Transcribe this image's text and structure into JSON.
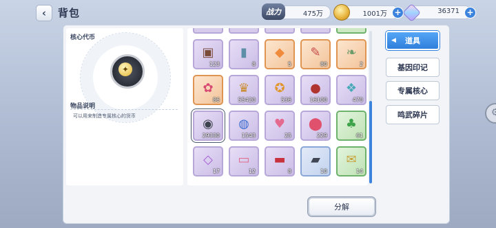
{
  "header": {
    "title": "背包",
    "resources": {
      "power": {
        "label": "战力",
        "value": "475万"
      },
      "coin": {
        "value": "1001万"
      },
      "gem": {
        "value": "36371"
      }
    }
  },
  "detail": {
    "item_name": "核心代币",
    "desc_title": "物品说明",
    "desc_text": "可以用来制造专属核心的货币"
  },
  "grid": {
    "items": [
      {
        "name": "chip",
        "count": "123",
        "frame": "purple"
      },
      {
        "name": "battery",
        "count": "8",
        "frame": "purple"
      },
      {
        "name": "orange-crystal",
        "count": "5",
        "frame": "orange"
      },
      {
        "name": "candy-cane",
        "count": "80",
        "frame": "orange"
      },
      {
        "name": "leaf-badge",
        "count": "2",
        "frame": "orange"
      },
      {
        "name": "pink-ribbon",
        "count": "86",
        "frame": "orange"
      },
      {
        "name": "trophy",
        "count": "55420",
        "frame": "purple"
      },
      {
        "name": "medal",
        "count": "536",
        "frame": "purple"
      },
      {
        "name": "red-seal",
        "count": "16100",
        "frame": "purple"
      },
      {
        "name": "cube-pack",
        "count": "470",
        "frame": "purple"
      },
      {
        "name": "core-token",
        "count": "29330",
        "frame": "purple"
      },
      {
        "name": "blue-orb",
        "count": "1543",
        "frame": "purple"
      },
      {
        "name": "ticket-heart",
        "count": "25",
        "frame": "purple"
      },
      {
        "name": "pink-coin",
        "count": "229",
        "frame": "purple"
      },
      {
        "name": "clover",
        "count": "61",
        "frame": "green"
      },
      {
        "name": "purple-gem",
        "count": "17",
        "frame": "purple"
      },
      {
        "name": "pink-ticket",
        "count": "12",
        "frame": "purple"
      },
      {
        "name": "red-box",
        "count": "8",
        "frame": "purple"
      },
      {
        "name": "knife",
        "count": "10",
        "frame": "blue"
      },
      {
        "name": "gold-ticket",
        "count": "14",
        "frame": "green"
      }
    ]
  },
  "tabs": [
    {
      "label": "道具",
      "active": true
    },
    {
      "label": "基因印记",
      "active": false
    },
    {
      "label": "专属核心",
      "active": false
    },
    {
      "label": "鸣武碎片",
      "active": false
    }
  ],
  "actions": {
    "decompose": "分解"
  }
}
